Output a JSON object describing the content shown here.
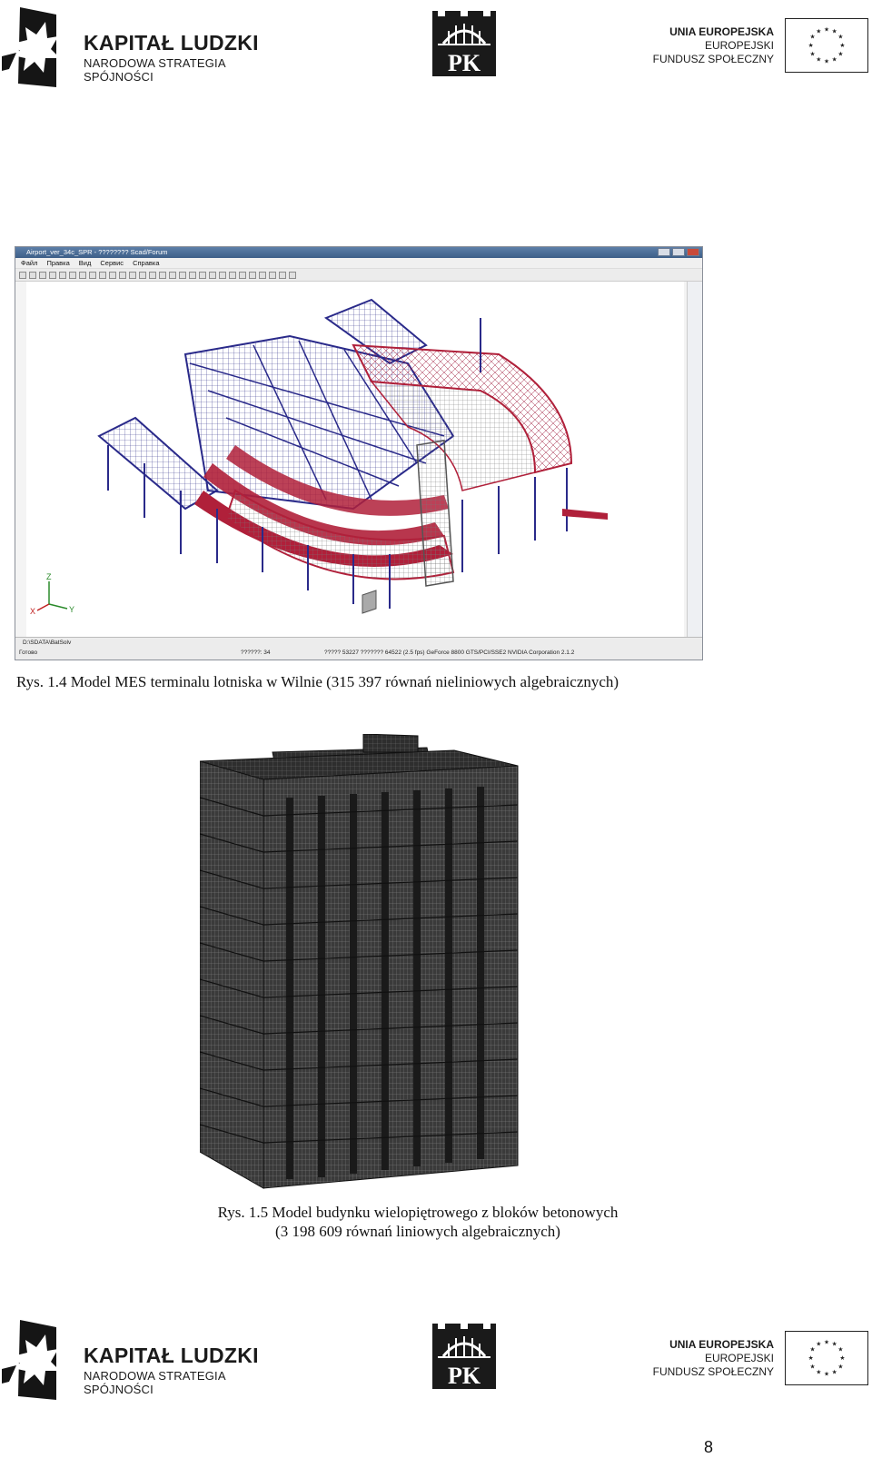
{
  "header": {
    "kapital_title": "KAPITAŁ LUDZKI",
    "kapital_subtitle": "NARODOWA STRATEGIA SPÓJNOŚCI",
    "pk_logo": "PK",
    "eu_line1": "UNIA EUROPEJSKA",
    "eu_line2": "EUROPEJSKI",
    "eu_line3": "FUNDUSZ SPOŁECZNY"
  },
  "figure1": {
    "window_title": "Airport_ver_34c_SPR - ???????? Scad/Forum",
    "menu": [
      "Файл",
      "Правка",
      "Вид",
      "Сервис",
      "Справка"
    ],
    "status_path": "D:\\SDATA\\BatSolv",
    "status_ready": "Готово",
    "status_coords": "??????: 34",
    "status_info": "????? 53227  ??????? 64522  (2.5 fps) GeForce 8800 GTS/PCI/SSE2 NVIDIA Corporation 2.1.2",
    "axis_z": "Z",
    "axis_y": "Y",
    "axis_x": "X",
    "caption": "Rys. 1.4 Model MES terminalu lotniska w Wilnie (315 397 równań nieliniowych algebraicznych)"
  },
  "figure2": {
    "caption_line1": "Rys. 1.5 Model budynku wielopiętrowego z bloków betonowych",
    "caption_line2": "(3 198 609 równań liniowych algebraicznych)"
  },
  "footer": {
    "kapital_title": "KAPITAŁ LUDZKI",
    "kapital_subtitle": "NARODOWA STRATEGIA SPÓJNOŚCI",
    "pk_logo": "PK",
    "eu_line1": "UNIA EUROPEJSKA",
    "eu_line2": "EUROPEJSKI",
    "eu_line3": "FUNDUSZ SPOŁECZNY"
  },
  "page_number": "8",
  "colors": {
    "structure_red": "#b0203a",
    "structure_blue": "#2a2a8a",
    "building_gray": "#3a3a3a",
    "eu_star": "#222222"
  }
}
